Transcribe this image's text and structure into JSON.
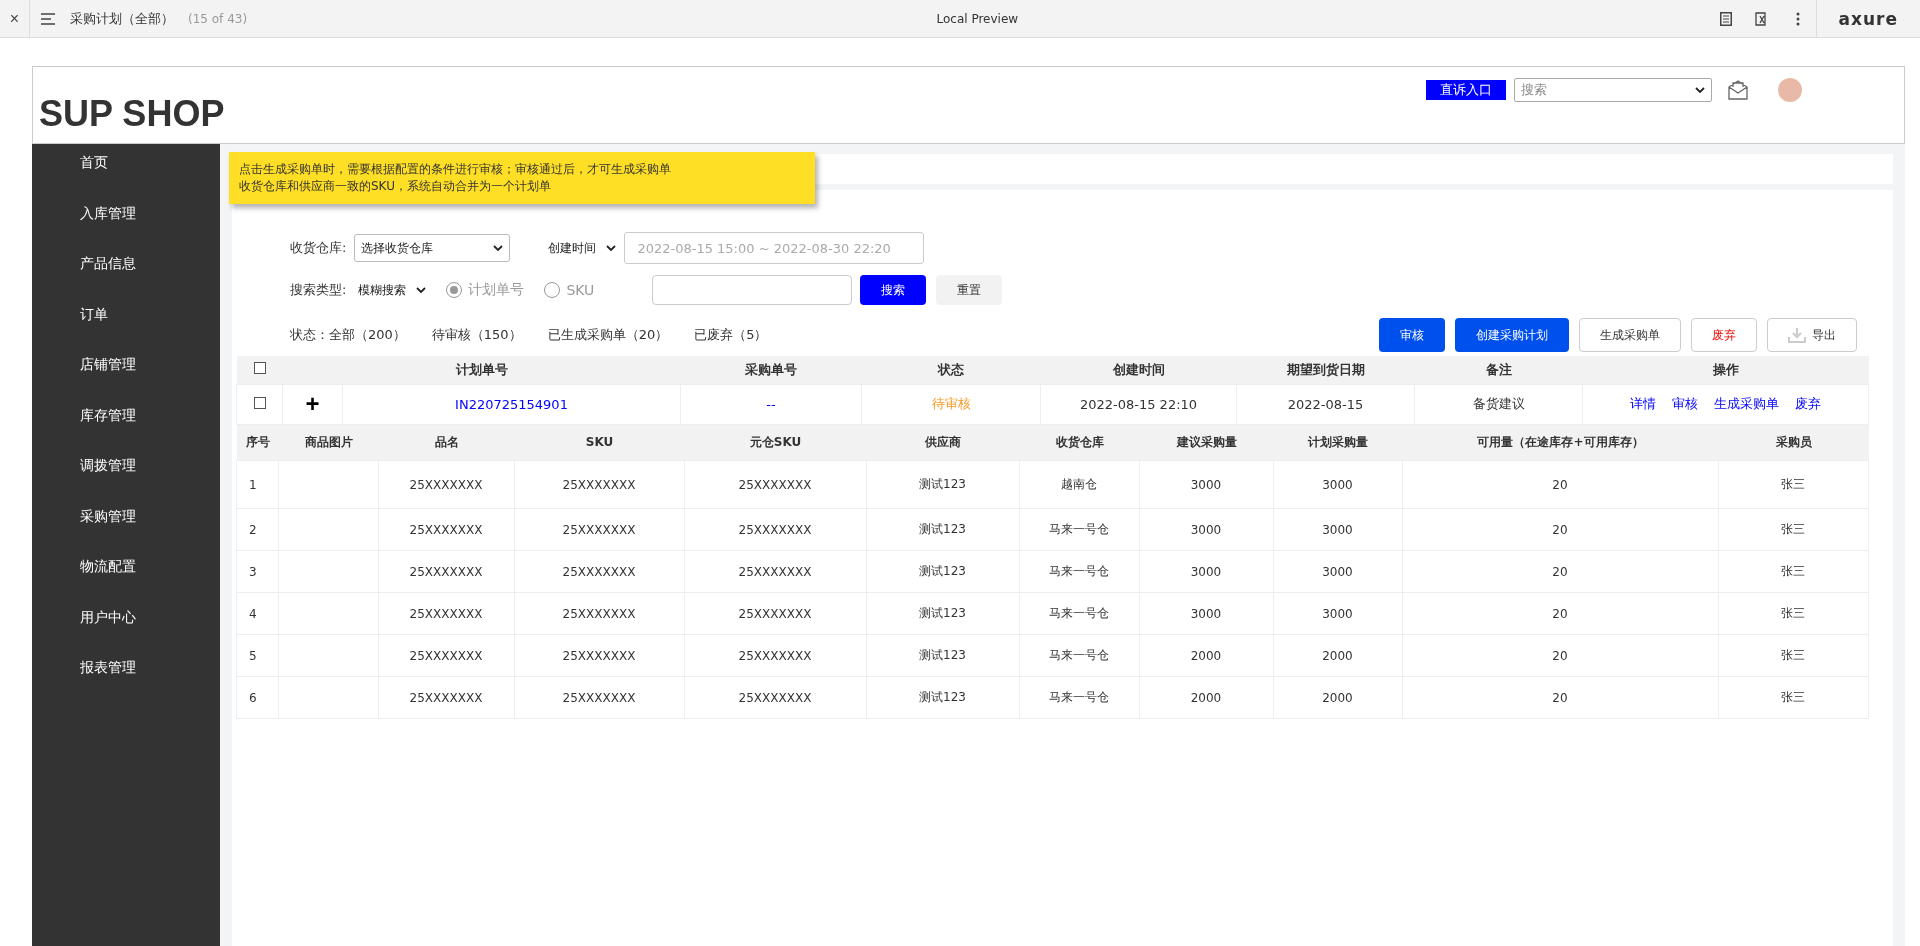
{
  "topbar": {
    "close": "×",
    "title": "采购计划（全部）",
    "page_count": "(15 of 43)",
    "center": "Local Preview",
    "logo": "axure"
  },
  "header": {
    "brand": "SUP SHOP",
    "complaint_button": "直诉入口",
    "search_placeholder": "搜索"
  },
  "sidebar": {
    "items": [
      {
        "label": "首页"
      },
      {
        "label": "入库管理"
      },
      {
        "label": "产品信息"
      },
      {
        "label": "订单"
      },
      {
        "label": "店铺管理"
      },
      {
        "label": "库存管理"
      },
      {
        "label": "调拨管理"
      },
      {
        "label": "采购管理"
      },
      {
        "label": "物流配置"
      },
      {
        "label": "用户中心"
      },
      {
        "label": "报表管理"
      }
    ]
  },
  "note": {
    "lines": [
      "点击生成采购单时，需要根据配置的条件进行审核；审核通过后，才可生成采购单",
      "收货仓库和供应商一致的SKU，系统自动合并为一个计划单"
    ]
  },
  "filters": {
    "warehouse_label": "收货仓库:",
    "warehouse_value": "选择收货仓库",
    "time_select": "创建时间",
    "time_range": "2022-08-15 15:00  ~  2022-08-30 22:20",
    "search_type_label": "搜索类型:",
    "search_type_value": "模糊搜索",
    "radios": [
      {
        "label": "计划单号",
        "selected": true
      },
      {
        "label": "SKU",
        "selected": false
      }
    ],
    "search_button": "搜索",
    "reset_button": "重置"
  },
  "status_tabs": [
    {
      "label": "状态：全部（200）"
    },
    {
      "label": "待审核（150）"
    },
    {
      "label": "已生成采购单（20）"
    },
    {
      "label": "已废弃（5）"
    }
  ],
  "actions": [
    {
      "label": "审核",
      "kind": "primary"
    },
    {
      "label": "创建采购计划",
      "kind": "primary"
    },
    {
      "label": "生成采购单",
      "kind": "plain"
    },
    {
      "label": "废弃",
      "kind": "danger"
    },
    {
      "label": "导出",
      "kind": "export"
    }
  ],
  "plan_table": {
    "header_checked": false,
    "columns": [
      "计划单号",
      "采购单号",
      "状态",
      "创建时间",
      "期望到货日期",
      "备注",
      "操作"
    ],
    "row": {
      "checked": false,
      "expand": "+",
      "plan_no": "IN220725154901",
      "po_no": "--",
      "status": "待审核",
      "created": "2022-08-15 22:10",
      "expected": "2022-08-15",
      "remark": "备货建议",
      "ops": [
        "详情",
        "审核",
        "生成采购单",
        "废弃"
      ]
    }
  },
  "items_table": {
    "columns": [
      "序号",
      "商品图片",
      "品名",
      "SKU",
      "元仓SKU",
      "供应商",
      "收货仓库",
      "建议采购量",
      "计划采购量",
      "可用量（在途库存+可用库存）",
      "采购员"
    ],
    "rows": [
      [
        "1",
        "",
        "25XXXXXXX",
        "25XXXXXXX",
        "25XXXXXXX",
        "测试123",
        "越南仓",
        "3000",
        "3000",
        "20",
        "张三"
      ],
      [
        "2",
        "",
        "25XXXXXXX",
        "25XXXXXXX",
        "25XXXXXXX",
        "测试123",
        "马来一号仓",
        "3000",
        "3000",
        "20",
        "张三"
      ],
      [
        "3",
        "",
        "25XXXXXXX",
        "25XXXXXXX",
        "25XXXXXXX",
        "测试123",
        "马来一号仓",
        "3000",
        "3000",
        "20",
        "张三"
      ],
      [
        "4",
        "",
        "25XXXXXXX",
        "25XXXXXXX",
        "25XXXXXXX",
        "测试123",
        "马来一号仓",
        "3000",
        "3000",
        "20",
        "张三"
      ],
      [
        "5",
        "",
        "25XXXXXXX",
        "25XXXXXXX",
        "25XXXXXXX",
        "测试123",
        "马来一号仓",
        "2000",
        "2000",
        "20",
        "张三"
      ],
      [
        "6",
        "",
        "25XXXXXXX",
        "25XXXXXXX",
        "25XXXXXXX",
        "测试123",
        "马来一号仓",
        "2000",
        "2000",
        "20",
        "张三"
      ]
    ]
  }
}
